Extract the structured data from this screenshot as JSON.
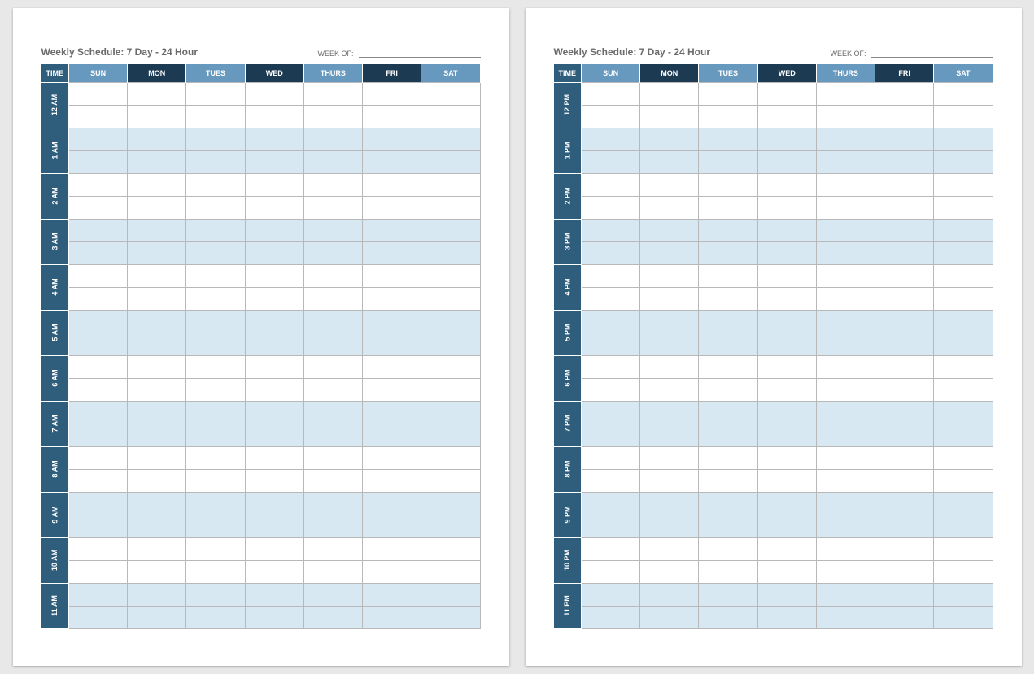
{
  "title": "Weekly Schedule: 7 Day - 24 Hour",
  "week_of_label": "WEEK OF:",
  "headers": {
    "time": "TIME",
    "sun": "SUN",
    "mon": "MON",
    "tues": "TUES",
    "wed": "WED",
    "thurs": "THURS",
    "fri": "FRI",
    "sat": "SAT"
  },
  "pages": [
    {
      "hours": [
        "12 AM",
        "1 AM",
        "2 AM",
        "3 AM",
        "4 AM",
        "5 AM",
        "6 AM",
        "7 AM",
        "8 AM",
        "9 AM",
        "10 AM",
        "11 AM"
      ]
    },
    {
      "hours": [
        "12 PM",
        "1 PM",
        "2 PM",
        "3 PM",
        "4 PM",
        "5 PM",
        "6 PM",
        "7 PM",
        "8 PM",
        "9 PM",
        "10 PM",
        "11 PM"
      ]
    }
  ],
  "column_shades": [
    "light",
    "dark",
    "light",
    "dark",
    "light",
    "dark",
    "light"
  ]
}
